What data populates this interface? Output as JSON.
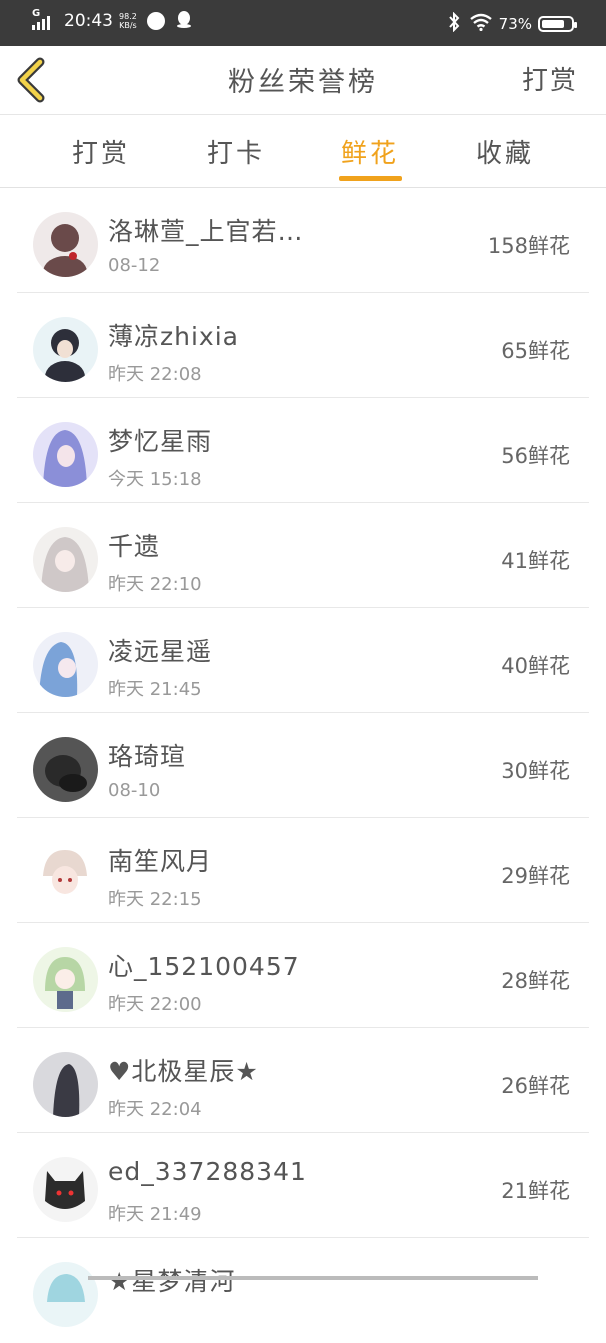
{
  "status_bar": {
    "time": "20:43",
    "net_speed_top": "98.2",
    "net_speed_bottom": "KB/s",
    "network": "G",
    "battery": "73%"
  },
  "nav": {
    "title": "粉丝荣誉榜",
    "right_action": "打赏"
  },
  "tabs": [
    {
      "label": "打赏",
      "active": false
    },
    {
      "label": "打卡",
      "active": false
    },
    {
      "label": "鲜花",
      "active": true
    },
    {
      "label": "收藏",
      "active": false
    }
  ],
  "accent_color": "#f0a21c",
  "rows": [
    {
      "name": "洛琳萱_上官若…",
      "time": "08-12",
      "count": "158鲜花",
      "avatar_color": "#6a4a4a"
    },
    {
      "name": "薄凉zhixia",
      "time": "昨天 22:08",
      "count": "65鲜花",
      "avatar_color": "#2d2f3a"
    },
    {
      "name": "梦忆星雨",
      "time": "今天 15:18",
      "count": "56鲜花",
      "avatar_color": "#8b8fd8"
    },
    {
      "name": "千遗",
      "time": "昨天 22:10",
      "count": "41鲜花",
      "avatar_color": "#cfc8c8"
    },
    {
      "name": "凌远星遥",
      "time": "昨天 21:45",
      "count": "40鲜花",
      "avatar_color": "#7ba3d8"
    },
    {
      "name": "珞琦瑄",
      "time": "08-10",
      "count": "30鲜花",
      "avatar_color": "#2a2a2a"
    },
    {
      "name": "南笙风月",
      "time": "昨天 22:15",
      "count": "29鲜花",
      "avatar_color": "#e8d8d0"
    },
    {
      "name": "心_152100457",
      "time": "昨天 22:00",
      "count": "28鲜花",
      "avatar_color": "#b7d6a5"
    },
    {
      "name": "♥北极星辰★",
      "time": "昨天 22:04",
      "count": "26鲜花",
      "avatar_color": "#3a3a44"
    },
    {
      "name": "ed_337288341",
      "time": "昨天 21:49",
      "count": "21鲜花",
      "avatar_color": "#2c2c2c"
    },
    {
      "name": "★星梦清河",
      "time": "",
      "count": "",
      "avatar_color": "#9fd5e0"
    }
  ]
}
